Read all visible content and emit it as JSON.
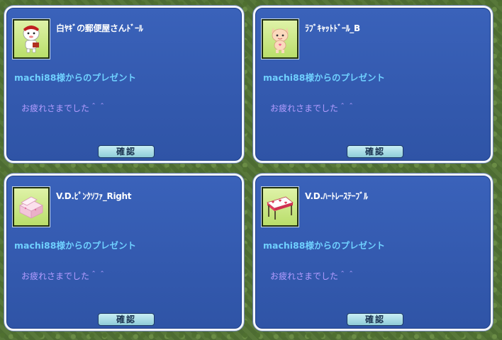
{
  "dialogs": [
    {
      "item_name": "白ﾔｷﾞの郵便屋さんﾄﾞｰﾙ",
      "icon": "goat-doll-icon",
      "sender": "machi88様からのプレゼント",
      "message": "お疲れさまでした＾＾",
      "button": "確認"
    },
    {
      "item_name": "ﾗﾌﾞｷｬｯﾄﾄﾞｰﾙ_B",
      "icon": "cat-doll-icon",
      "sender": "machi88様からのプレゼント",
      "message": "お疲れさまでした＾＾",
      "button": "確認"
    },
    {
      "item_name": "V.D.ﾋﾟﾝｸｿﾌｧ_Right",
      "icon": "pink-sofa-icon",
      "sender": "machi88様からのプレゼント",
      "message": "お疲れさまでした＾＾",
      "button": "確認"
    },
    {
      "item_name": "V.D.ﾊｰﾄﾚｰｽﾃｰﾌﾞﾙ",
      "icon": "heart-lace-table-icon",
      "sender": "machi88様からのプレゼント",
      "message": "お疲れさまでした＾＾",
      "button": "確認"
    }
  ],
  "colors": {
    "panel": "#3359ae",
    "sender_text": "#6fd0ff",
    "message_text": "#b39cff",
    "icon_bg": "#c8e58a"
  }
}
